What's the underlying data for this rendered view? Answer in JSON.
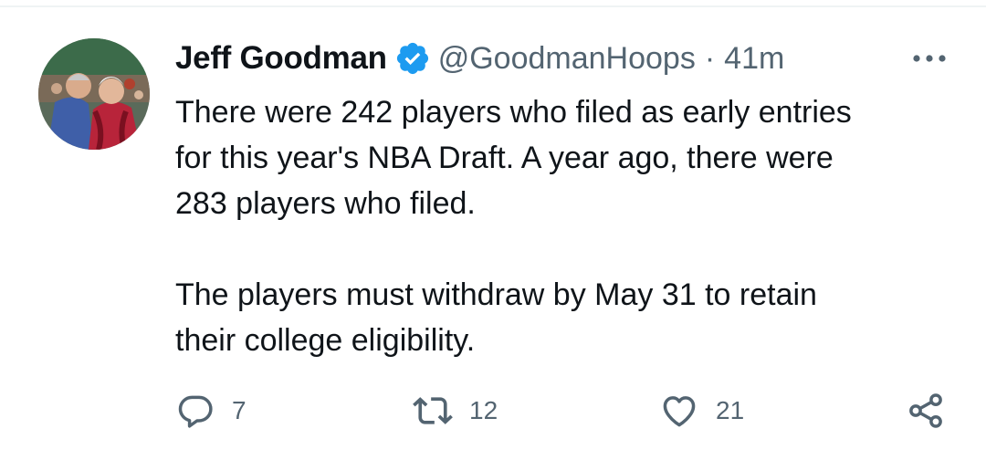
{
  "tweet": {
    "author": {
      "display_name": "Jeff Goodman",
      "handle": "@GoodmanHoops",
      "verified": true
    },
    "separator": "·",
    "timestamp": "41m",
    "text": "There were 242 players who filed as early entries\nfor this year's NBA Draft. A year ago, there were\n283 players who filed.\n\nThe players must withdraw by May 31 to retain\ntheir college eligibility.",
    "stats": {
      "replies": "7",
      "retweets": "12",
      "likes": "21"
    }
  },
  "colors": {
    "text_primary": "#0f1419",
    "text_secondary": "#536471",
    "verified_blue": "#1d9bf0",
    "divider": "#eff3f4"
  },
  "icons": {
    "verified": "verified-badge-icon",
    "more": "more-horizontal-icon",
    "reply": "reply-icon",
    "retweet": "retweet-icon",
    "like": "heart-icon",
    "share": "share-icon"
  }
}
